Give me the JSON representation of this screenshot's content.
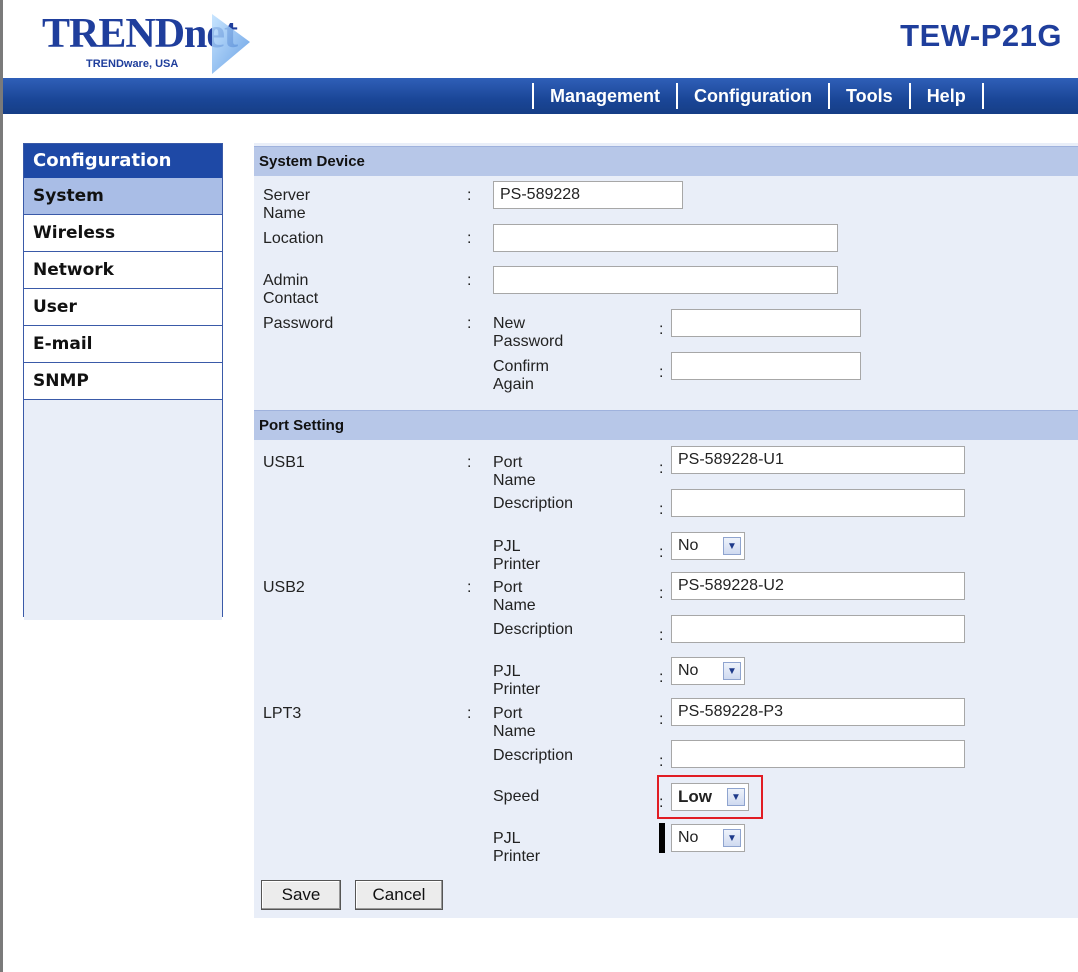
{
  "header": {
    "logo_text": "TRENDnet",
    "logo_sub": "TRENDware, USA",
    "product": "TEW-P21G"
  },
  "nav": [
    "Management",
    "Configuration",
    "Tools",
    "Help"
  ],
  "sidebar": {
    "title": "Configuration",
    "items": [
      "System",
      "Wireless",
      "Network",
      "User",
      "E-mail",
      "SNMP"
    ],
    "active": "System"
  },
  "system_device": {
    "title": "System Device",
    "server_name_label": "Server Name",
    "server_name_value": "PS-589228",
    "location_label": "Location",
    "location_value": "",
    "admin_contact_label": "Admin Contact",
    "admin_contact_value": "",
    "password_label": "Password",
    "new_password_label": "New Password",
    "confirm_again_label": "Confirm Again"
  },
  "port_setting": {
    "title": "Port Setting",
    "port_name_label": "Port Name",
    "description_label": "Description",
    "pjl_label": "PJL Printer",
    "speed_label": "Speed",
    "usb1": {
      "label": "USB1",
      "port_name": "PS-589228-U1",
      "description": "",
      "pjl": "No"
    },
    "usb2": {
      "label": "USB2",
      "port_name": "PS-589228-U2",
      "description": "",
      "pjl": "No"
    },
    "lpt3": {
      "label": "LPT3",
      "port_name": "PS-589228-P3",
      "description": "",
      "speed": "Low",
      "pjl": "No"
    }
  },
  "colon": ":",
  "buttons": {
    "save": "Save",
    "cancel": "Cancel"
  },
  "colors": {
    "brand_blue": "#1f3e9c",
    "nav_blue": "#1a4697",
    "highlight_red": "#e11c24"
  },
  "icons": {
    "dropdown": "chevron-down-icon",
    "logo_mark": "logo-triangle-icon"
  }
}
